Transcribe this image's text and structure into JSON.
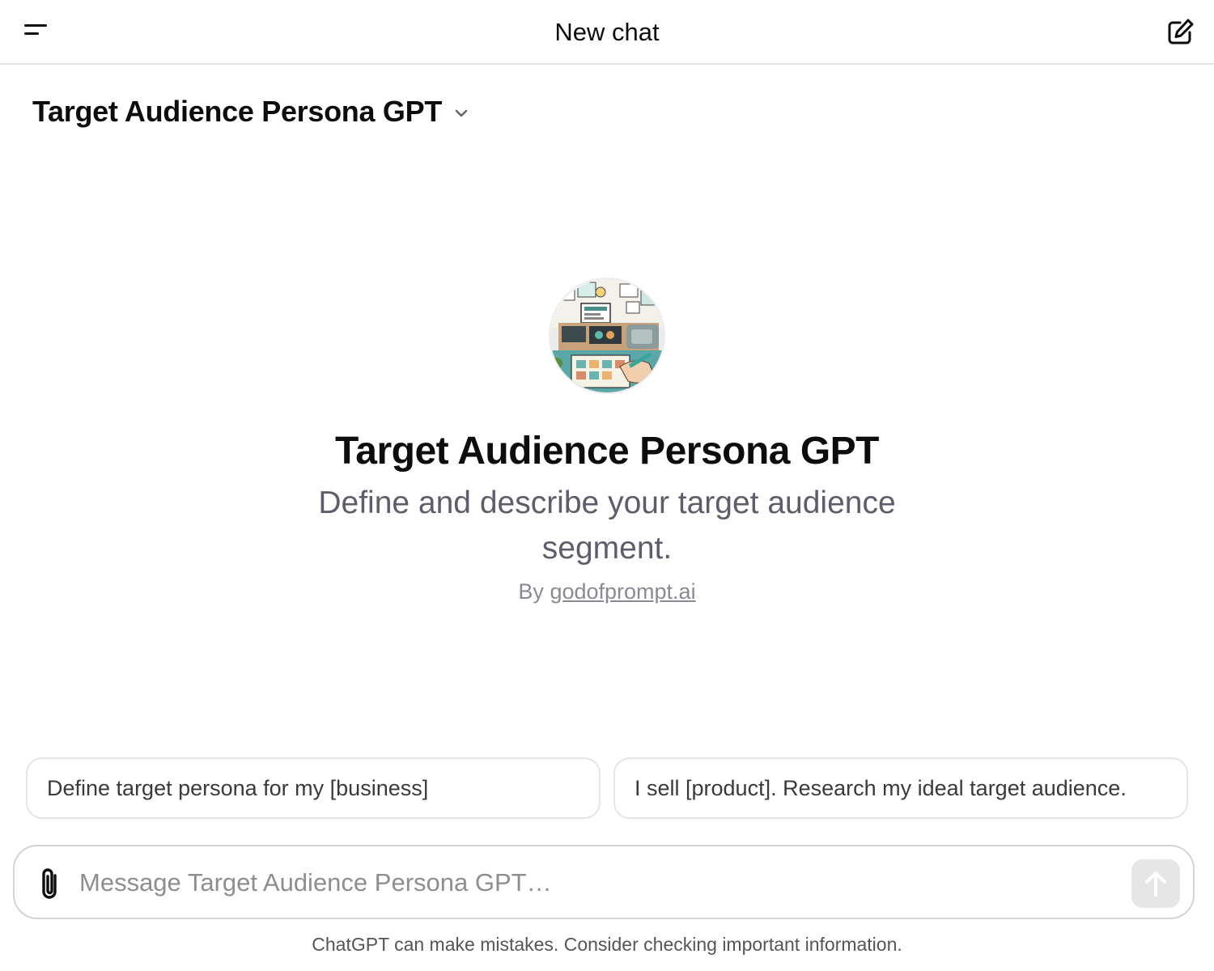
{
  "header": {
    "title": "New chat",
    "menu_icon": "hamburger-icon",
    "new_chat_icon": "compose-icon"
  },
  "gpt_selector": {
    "label": "Target Audience Persona GPT",
    "chevron_icon": "chevron-down-icon"
  },
  "gpt_profile": {
    "avatar": "gpt-avatar-image",
    "title": "Target Audience Persona GPT",
    "description": "Define and describe your target audience segment.",
    "author_prefix": "By",
    "author": "godofprompt.ai"
  },
  "conversation_starters": [
    {
      "label": "Define target persona for my [business]"
    },
    {
      "label": "I sell [product]. Research my ideal target audience."
    }
  ],
  "composer": {
    "placeholder": "Message Target Audience Persona GPT…",
    "value": "",
    "attach_icon": "paperclip-icon",
    "send_icon": "arrow-up-icon"
  },
  "footer": {
    "disclaimer": "ChatGPT can make mistakes. Consider checking important information."
  },
  "colors": {
    "text_primary": "#0d0d0d",
    "text_secondary": "#5d5d6b",
    "border": "#e3e3e3",
    "send_disabled": "#e6e6e6"
  }
}
